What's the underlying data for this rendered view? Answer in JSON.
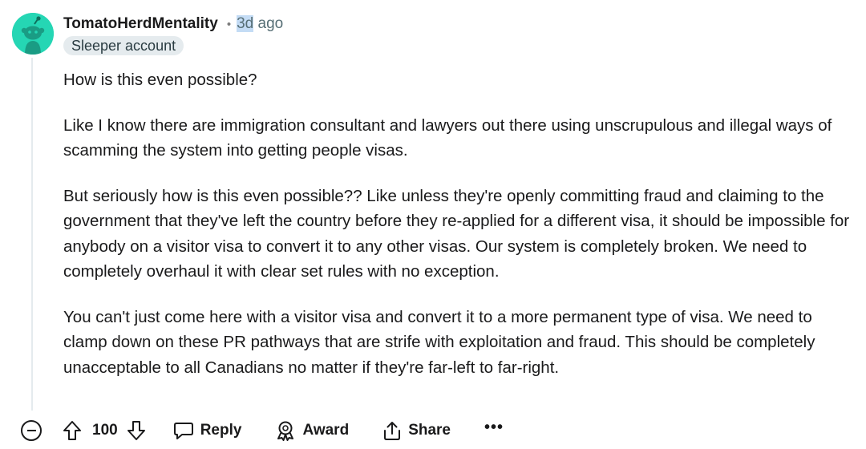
{
  "comment": {
    "author": "TomatoHerdMentality",
    "separator": "•",
    "time_highlighted": "3d",
    "time_rest": " ago",
    "flair": "Sleeper account",
    "paragraphs": [
      "How is this even possible?",
      "Like I know there are immigration consultant and lawyers out there using unscrupulous and illegal ways of scamming the system into getting people visas.",
      "But seriously how is this even possible?? Like unless they're openly committing fraud and claiming to the government that they've left the country before they re-applied for a different visa, it should be impossible for anybody on a visitor visa to convert it to any other visas. Our system is completely broken. We need to completely overhaul it with clear set rules with no exception.",
      "You can't just come here with a visitor visa and convert it to a more permanent type of visa. We need to clamp down on these PR pathways that are strife with exploitation and fraud. This should be completely unacceptable to all Canadians no matter if they're far-left to far-right."
    ]
  },
  "actions": {
    "score": "100",
    "reply_label": "Reply",
    "award_label": "Award",
    "share_label": "Share",
    "more_label": "•••"
  },
  "icons": {
    "avatar": "snoo-avatar-icon",
    "collapse": "collapse-minus-icon",
    "upvote": "upvote-arrow-icon",
    "downvote": "downvote-arrow-icon",
    "reply": "speech-bubble-icon",
    "award": "award-ribbon-icon",
    "share": "share-upload-icon",
    "more": "ellipsis-icon"
  },
  "colors": {
    "avatar_bg": "#25d6b4",
    "time_highlight": "#c4dcf5",
    "flair_bg": "#e5ebee",
    "meta_text": "#576f76"
  }
}
